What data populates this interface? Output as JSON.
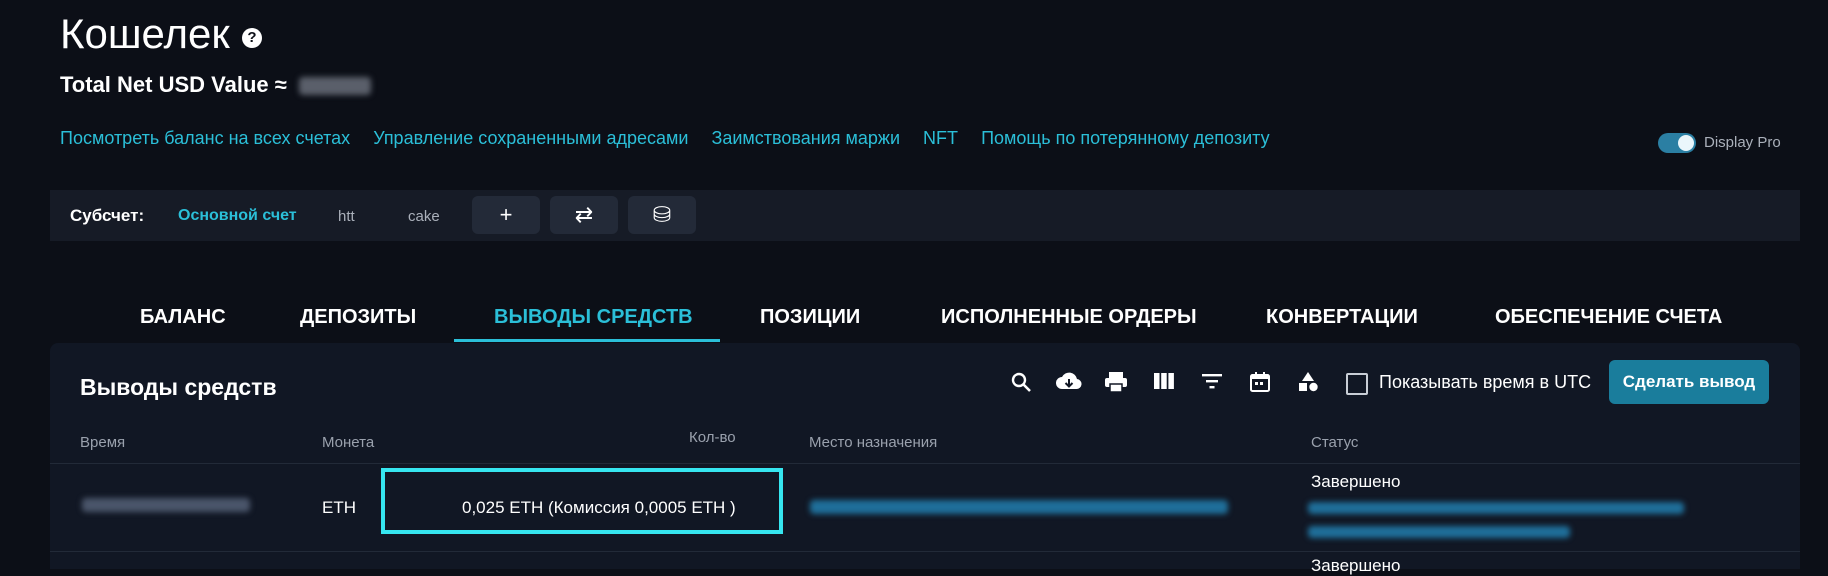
{
  "header": {
    "title": "Кошелек",
    "help_icon": "question-circle-icon",
    "net_value_label": "Total Net USD Value ≈"
  },
  "links": [
    "Посмотреть баланс на всех счетах",
    "Управление сохраненными адресами",
    "Заимствования маржи",
    "NFT",
    "Помощь по потерянному депозиту"
  ],
  "display_pro": {
    "label": "Display Pro",
    "enabled": true
  },
  "subaccount": {
    "label": "Субсчет:",
    "main": "Основной счет",
    "accounts": [
      "htt",
      "cake"
    ],
    "add_symbol": "+",
    "transfer_symbol": "⇄",
    "manage_symbol": "⛁"
  },
  "tabs": [
    "БАЛАНС",
    "ДЕПОЗИТЫ",
    "ВЫВОДЫ СРЕДСТВ",
    "ПОЗИЦИИ",
    "ИСПОЛНЕННЫЕ ОРДЕРЫ",
    "КОНВЕРТАЦИИ",
    "ОБЕСПЕЧЕНИЕ СЧЕТА"
  ],
  "active_tab": "ВЫВОДЫ СРЕДСТВ",
  "panel": {
    "title": "Выводы средств",
    "utc_label": "Показывать время в UTC",
    "withdraw_button": "Сделать вывод",
    "tools": [
      "search-icon",
      "download-icon",
      "print-icon",
      "columns-icon",
      "filter-icon",
      "calendar-icon",
      "shapes-icon"
    ]
  },
  "table": {
    "columns": {
      "time": "Время",
      "coin": "Монета",
      "amount": "Кол-во",
      "destination": "Место назначения",
      "status": "Статус"
    },
    "rows": [
      {
        "coin": "ETH",
        "amount": "0,025 ETH (Комиссия 0,0005 ETH )",
        "status": "Завершено"
      },
      {
        "status": "Завершено"
      }
    ]
  },
  "colors": {
    "accent": "#2bbfd8",
    "button": "#1a7d9c",
    "highlight": "#36e6f0",
    "background": "#0c0f17"
  }
}
